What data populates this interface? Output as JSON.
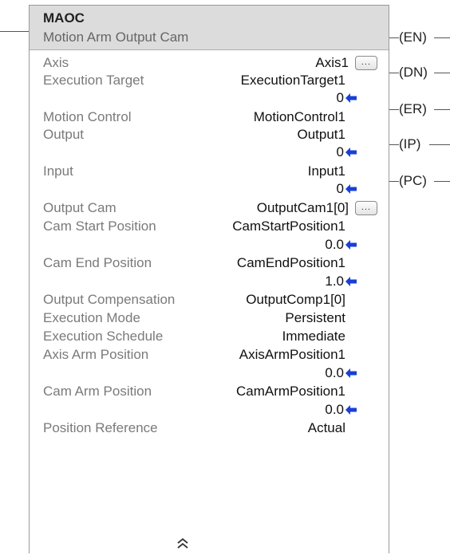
{
  "block": {
    "mnemonic": "MAOC",
    "description": "Motion Arm Output Cam"
  },
  "operands": [
    {
      "label": "Axis",
      "value": "Axis1",
      "browse": true
    },
    {
      "label": "Execution Target",
      "value": "ExecutionTarget1",
      "sub_value": "0"
    },
    {
      "label": "Motion Control",
      "value": "MotionControl1"
    },
    {
      "label": "Output",
      "value": "Output1",
      "sub_value": "0"
    },
    {
      "label": "Input",
      "value": "Input1",
      "sub_value": "0"
    },
    {
      "label": "Output Cam",
      "value": "OutputCam1[0]",
      "browse": true
    },
    {
      "label": "Cam Start Position",
      "value": "CamStartPosition1",
      "sub_value": "0.0"
    },
    {
      "label": "Cam End Position",
      "value": "CamEndPosition1",
      "sub_value": "1.0"
    },
    {
      "label": "Output Compensation",
      "value": "OutputComp1[0]"
    },
    {
      "label": "Execution Mode",
      "value": "Persistent"
    },
    {
      "label": "Execution Schedule",
      "value": "Immediate"
    },
    {
      "label": "Axis Arm Position",
      "value": "AxisArmPosition1",
      "sub_value": "0.0"
    },
    {
      "label": "Cam Arm Position",
      "value": "CamArmPosition1",
      "sub_value": "0.0"
    },
    {
      "label": "Position Reference",
      "value": "Actual"
    }
  ],
  "browse_button_label": "...",
  "collapse_icon": "double-chevron-up-icon",
  "collapse_glyph": "≈",
  "output_pins": [
    "EN",
    "DN",
    "ER",
    "IP",
    "PC"
  ],
  "colors": {
    "header_bg": "#dcdcdc",
    "label_text": "#7a7a7a",
    "value_text": "#111111",
    "arrow": "#1a3fd6",
    "border": "#999999"
  }
}
